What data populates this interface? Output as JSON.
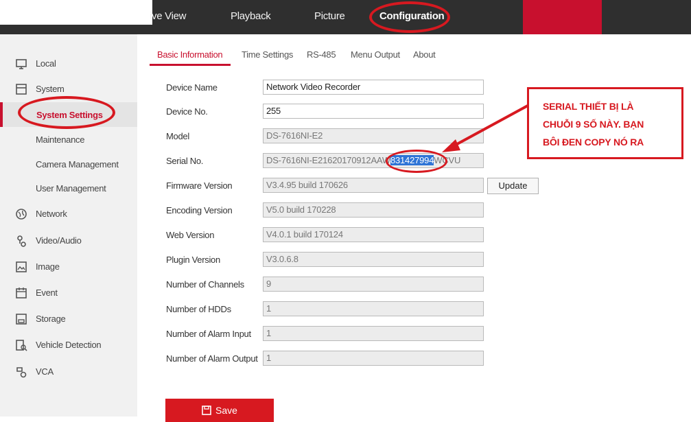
{
  "topnav": {
    "live_view": "ive View",
    "playback": "Playback",
    "picture": "Picture",
    "configuration": "Configuration"
  },
  "sidebar": {
    "items": [
      {
        "label": "Local",
        "icon": "monitor-icon"
      },
      {
        "label": "System",
        "icon": "system-icon"
      },
      {
        "label": "Network",
        "icon": "globe-icon"
      },
      {
        "label": "Video/Audio",
        "icon": "video-audio-icon"
      },
      {
        "label": "Image",
        "icon": "image-icon"
      },
      {
        "label": "Event",
        "icon": "calendar-icon"
      },
      {
        "label": "Storage",
        "icon": "storage-icon"
      },
      {
        "label": "Vehicle Detection",
        "icon": "vehicle-detection-icon"
      },
      {
        "label": "VCA",
        "icon": "vca-icon"
      }
    ],
    "system_sub": [
      "System Settings",
      "Maintenance",
      "Camera Management",
      "User Management"
    ]
  },
  "tabs": [
    "Basic Information",
    "Time Settings",
    "RS-485",
    "Menu Output",
    "About"
  ],
  "form": {
    "device_name_label": "Device Name",
    "device_name": "Network Video Recorder",
    "device_no_label": "Device No.",
    "device_no": "255",
    "model_label": "Model",
    "model": "DS-7616NI-E2",
    "serial_label": "Serial No.",
    "serial_prefix": "DS-7616NI-E21620170912AAW",
    "serial_highlight": "831427994",
    "serial_suffix": "WCVU",
    "firmware_label": "Firmware Version",
    "firmware": "V3.4.95 build 170626",
    "update_label": "Update",
    "encoding_label": "Encoding Version",
    "encoding": "V5.0 build 170228",
    "web_label": "Web Version",
    "web": "V4.0.1 build 170124",
    "plugin_label": "Plugin Version",
    "plugin": "V3.0.6.8",
    "channels_label": "Number of Channels",
    "channels": "9",
    "hdds_label": "Number of HDDs",
    "hdds": "1",
    "alarm_in_label": "Number of Alarm Input",
    "alarm_in": "1",
    "alarm_out_label": "Number of Alarm Output",
    "alarm_out": "1",
    "save_label": "Save"
  },
  "annotation": {
    "lines": [
      "SERIAL THIẾT BỊ LÀ",
      "CHUỖI 9 SỐ NÀY. BẠN",
      "BÔI ĐEN COPY NÓ RA"
    ]
  },
  "colors": {
    "accent": "#c8102e",
    "annotation": "#d71920",
    "topbar": "#2f2f2f",
    "selection": "#2e74d6"
  }
}
